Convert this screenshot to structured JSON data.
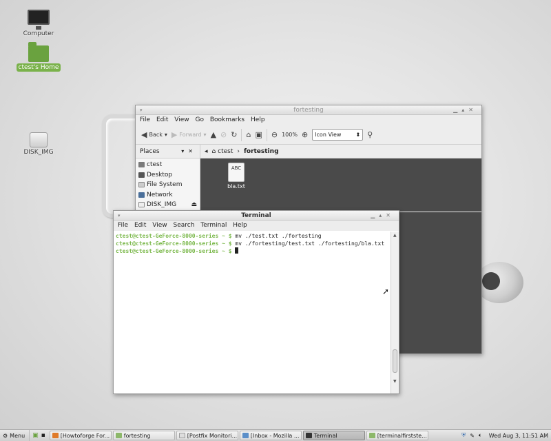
{
  "desktop": {
    "icons": [
      {
        "label": "Computer",
        "icon": "computer-icon"
      },
      {
        "label": "ctest's Home",
        "icon": "home-folder-icon"
      },
      {
        "label": "DISK_IMG",
        "icon": "usb-drive-icon"
      }
    ]
  },
  "file_manager": {
    "title": "fortesting",
    "menu": [
      "File",
      "Edit",
      "View",
      "Go",
      "Bookmarks",
      "Help"
    ],
    "toolbar": {
      "back": "Back",
      "forward": "Forward",
      "zoom": "100%",
      "view_mode": "Icon View"
    },
    "places_label": "Places",
    "breadcrumb": [
      "ctest",
      "fortesting"
    ],
    "sidebar": [
      "ctest",
      "Desktop",
      "File System",
      "Network",
      "DISK_IMG"
    ],
    "files": [
      {
        "name": "bla.txt",
        "preview": "ABC"
      }
    ]
  },
  "terminal": {
    "title": "Terminal",
    "menu": [
      "File",
      "Edit",
      "View",
      "Search",
      "Terminal",
      "Help"
    ],
    "lines": [
      {
        "prompt": "ctest@ctest-GeForce-8000-series ~ $ ",
        "command": "mv ./test.txt ./fortesting"
      },
      {
        "prompt": "ctest@ctest-GeForce-8000-series ~ $ ",
        "command": "mv ./fortesting/test.txt ./fortesting/bla.txt"
      },
      {
        "prompt": "ctest@ctest-GeForce-8000-series ~ $ ",
        "command": ""
      }
    ]
  },
  "taskbar": {
    "menu_label": "Menu",
    "tasks": [
      {
        "label": "[Howtoforge For...",
        "icon_color": "#e07b2a"
      },
      {
        "label": "fortesting",
        "icon_color": "#8db86a"
      },
      {
        "label": "[Postfix Monitori...",
        "icon_color": "#dddddd"
      },
      {
        "label": "[Inbox - Mozilla ...",
        "icon_color": "#5b8fc9"
      },
      {
        "label": "Terminal",
        "icon_color": "#333333"
      },
      {
        "label": "[terminalfirstste...",
        "icon_color": "#8db86a"
      }
    ],
    "clock": "Wed Aug  3, 11:51 AM"
  }
}
